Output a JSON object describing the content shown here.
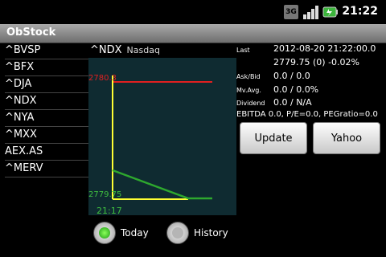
{
  "status_bar": {
    "network": "3G",
    "time": "21:22"
  },
  "app": {
    "title": "ObStock"
  },
  "symbols": [
    "^BVSP",
    "^BFX",
    "^DJA",
    "^NDX",
    "^NYA",
    "^MXX",
    "AEX.AS",
    "^MERV"
  ],
  "chart": {
    "symbol": "^NDX",
    "name": "Nasdaq",
    "ref_value": "2780.3",
    "last_value": "2779.75",
    "time": "21:17"
  },
  "quote": {
    "last_key": "Last",
    "last_date": "2012-08-20 21:22:00.0",
    "last_value": "2779.75 (0) -0.02%",
    "askbid_key": "Ask/Bid",
    "askbid_value": "0.0 / 0.0",
    "mvavg_key": "Mv.Avg.",
    "mvavg_value": "0.0 / 0.0%",
    "dividend_key": "Dividend",
    "dividend_value": "0.0 / N/A",
    "ebitda_line": "EBITDA 0.0, P/E=0.0, PEGratio=0.0"
  },
  "buttons": {
    "update": "Update",
    "yahoo": "Yahoo"
  },
  "radios": {
    "today": "Today",
    "history": "History",
    "selected": "Today"
  },
  "colors": {
    "ref_line": "#e02020",
    "axis": "#ffff33",
    "price_line": "#2ea82e",
    "chart_bg": "#0f2b31"
  },
  "icons": [
    "network-3g-icon",
    "signal-icon",
    "battery-icon"
  ]
}
